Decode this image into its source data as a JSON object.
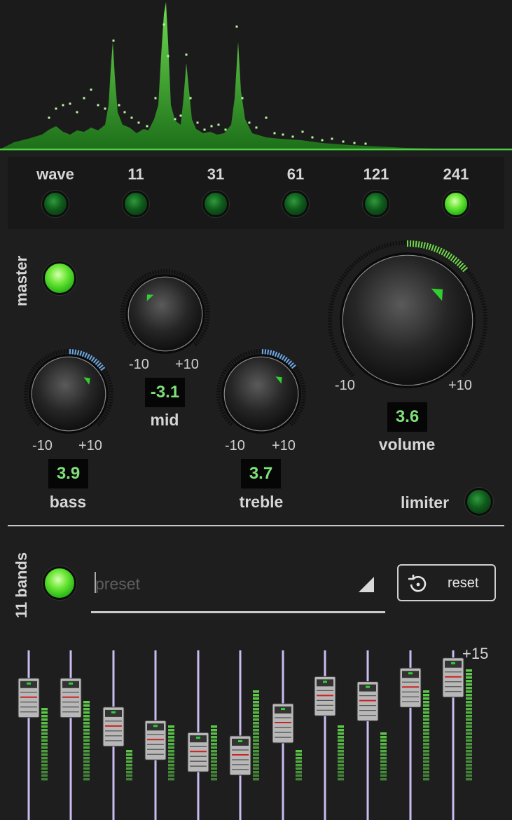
{
  "spectrum_icon": "spectrum-analyzer-display",
  "modes": [
    {
      "label": "wave",
      "on": false
    },
    {
      "label": "11",
      "on": false
    },
    {
      "label": "31",
      "on": false
    },
    {
      "label": "61",
      "on": false
    },
    {
      "label": "121",
      "on": false
    },
    {
      "label": "241",
      "on": true
    }
  ],
  "master": {
    "label": "master",
    "on": true
  },
  "knobs": {
    "mid": {
      "label": "mid",
      "value": "-3.1",
      "min": "-10",
      "max": "+10"
    },
    "bass": {
      "label": "bass",
      "value": "3.9",
      "min": "-10",
      "max": "+10"
    },
    "treble": {
      "label": "treble",
      "value": "3.7",
      "min": "-10",
      "max": "+10"
    },
    "volume": {
      "label": "volume",
      "value": "3.6",
      "min": "-10",
      "max": "+10"
    }
  },
  "limiter": {
    "label": "limiter",
    "on": false
  },
  "bands": {
    "label": "11 bands",
    "on": true
  },
  "preset": {
    "placeholder": "preset"
  },
  "reset": {
    "label": "reset",
    "icon": "reset-icon"
  },
  "eq": {
    "top_label": "+15",
    "slider_levels": [
      0.72,
      0.72,
      0.55,
      0.47,
      0.4,
      0.38,
      0.57,
      0.73,
      0.7,
      0.78,
      0.84
    ],
    "meter_levels": [
      0.45,
      0.48,
      0.2,
      0.35,
      0.35,
      0.55,
      0.2,
      0.35,
      0.3,
      0.55,
      0.68
    ],
    "colors": {
      "line": "#cbbcf0",
      "meter": "#5fcf4a",
      "accent": "#33dd33"
    }
  },
  "colors": {
    "accent_green": "#7fe07a",
    "knob_arc_blue": "#6aa8e8",
    "knob_arc_green": "#6fd94a"
  }
}
